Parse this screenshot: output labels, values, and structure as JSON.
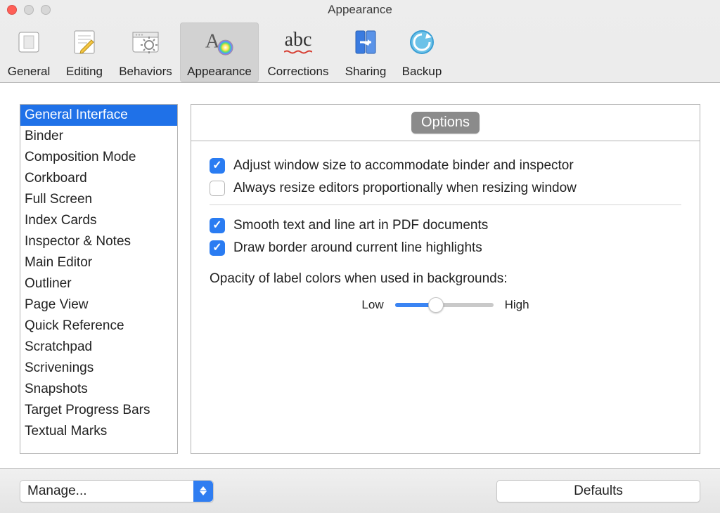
{
  "window": {
    "title": "Appearance"
  },
  "toolbar": {
    "items": [
      {
        "label": "General"
      },
      {
        "label": "Editing"
      },
      {
        "label": "Behaviors"
      },
      {
        "label": "Appearance"
      },
      {
        "label": "Corrections"
      },
      {
        "label": "Sharing"
      },
      {
        "label": "Backup"
      }
    ],
    "selected_index": 3
  },
  "sidebar": {
    "items": [
      "General Interface",
      "Binder",
      "Composition Mode",
      "Corkboard",
      "Full Screen",
      "Index Cards",
      "Inspector & Notes",
      "Main Editor",
      "Outliner",
      "Page View",
      "Quick Reference",
      "Scratchpad",
      "Scrivenings",
      "Snapshots",
      "Target Progress Bars",
      "Textual Marks"
    ],
    "selected_index": 0
  },
  "panel": {
    "tab_label": "Options",
    "checkbox1": {
      "label": "Adjust window size to accommodate binder and inspector",
      "checked": true
    },
    "checkbox2": {
      "label": "Always resize editors proportionally when resizing window",
      "checked": false
    },
    "checkbox3": {
      "label": "Smooth text and line art in PDF documents",
      "checked": true
    },
    "checkbox4": {
      "label": "Draw border around current line highlights",
      "checked": true
    },
    "opacity_label": "Opacity of label colors when used in backgrounds:",
    "slider": {
      "low": "Low",
      "high": "High",
      "value_percent": 42
    }
  },
  "footer": {
    "manage_label": "Manage...",
    "defaults_label": "Defaults"
  },
  "icons": {
    "corrections_text": "abc"
  }
}
